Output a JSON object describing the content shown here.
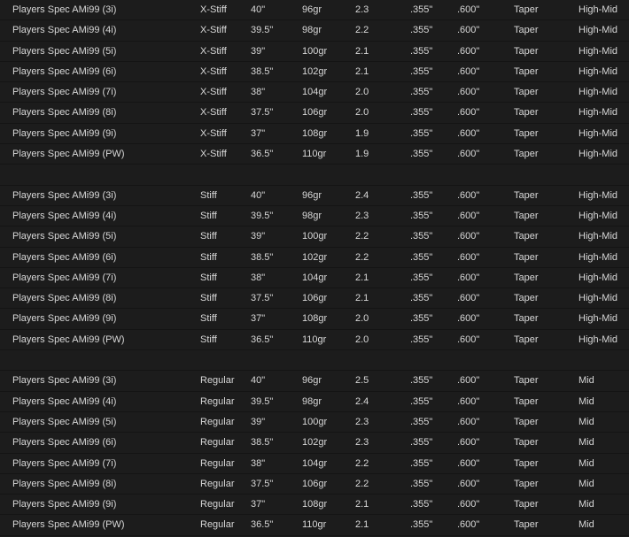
{
  "groups": [
    {
      "rows": [
        [
          "Players Spec AMi99 (3i)",
          "X-Stiff",
          "40\"",
          "96gr",
          "2.3",
          ".355\"",
          ".600\"",
          "Taper",
          "High-Mid"
        ],
        [
          "Players Spec AMi99 (4i)",
          "X-Stiff",
          "39.5\"",
          "98gr",
          "2.2",
          ".355\"",
          ".600\"",
          "Taper",
          "High-Mid"
        ],
        [
          "Players Spec AMi99 (5i)",
          "X-Stiff",
          "39\"",
          "100gr",
          "2.1",
          ".355\"",
          ".600\"",
          "Taper",
          "High-Mid"
        ],
        [
          "Players Spec AMi99 (6i)",
          "X-Stiff",
          "38.5\"",
          "102gr",
          "2.1",
          ".355\"",
          ".600\"",
          "Taper",
          "High-Mid"
        ],
        [
          "Players Spec AMi99 (7i)",
          "X-Stiff",
          "38\"",
          "104gr",
          "2.0",
          ".355\"",
          ".600\"",
          "Taper",
          "High-Mid"
        ],
        [
          "Players Spec AMi99 (8i)",
          "X-Stiff",
          "37.5\"",
          "106gr",
          "2.0",
          ".355\"",
          ".600\"",
          "Taper",
          "High-Mid"
        ],
        [
          "Players Spec AMi99 (9i)",
          "X-Stiff",
          "37\"",
          "108gr",
          "1.9",
          ".355\"",
          ".600\"",
          "Taper",
          "High-Mid"
        ],
        [
          "Players Spec AMi99 (PW)",
          "X-Stiff",
          "36.5\"",
          "110gr",
          "1.9",
          ".355\"",
          ".600\"",
          "Taper",
          "High-Mid"
        ]
      ]
    },
    {
      "rows": [
        [
          "Players Spec AMi99 (3i)",
          "Stiff",
          "40\"",
          "96gr",
          "2.4",
          ".355\"",
          ".600\"",
          "Taper",
          "High-Mid"
        ],
        [
          "Players Spec AMi99 (4i)",
          "Stiff",
          "39.5\"",
          "98gr",
          "2.3",
          ".355\"",
          ".600\"",
          "Taper",
          "High-Mid"
        ],
        [
          "Players Spec AMi99 (5i)",
          "Stiff",
          "39\"",
          "100gr",
          "2.2",
          ".355\"",
          ".600\"",
          "Taper",
          "High-Mid"
        ],
        [
          "Players Spec AMi99 (6i)",
          "Stiff",
          "38.5\"",
          "102gr",
          "2.2",
          ".355\"",
          ".600\"",
          "Taper",
          "High-Mid"
        ],
        [
          "Players Spec AMi99 (7i)",
          "Stiff",
          "38\"",
          "104gr",
          "2.1",
          ".355\"",
          ".600\"",
          "Taper",
          "High-Mid"
        ],
        [
          "Players Spec AMi99 (8i)",
          "Stiff",
          "37.5\"",
          "106gr",
          "2.1",
          ".355\"",
          ".600\"",
          "Taper",
          "High-Mid"
        ],
        [
          "Players Spec AMi99 (9i)",
          "Stiff",
          "37\"",
          "108gr",
          "2.0",
          ".355\"",
          ".600\"",
          "Taper",
          "High-Mid"
        ],
        [
          "Players Spec AMi99 (PW)",
          "Stiff",
          "36.5\"",
          "110gr",
          "2.0",
          ".355\"",
          ".600\"",
          "Taper",
          "High-Mid"
        ]
      ]
    },
    {
      "rows": [
        [
          "Players Spec AMi99 (3i)",
          "Regular",
          "40\"",
          "96gr",
          "2.5",
          ".355\"",
          ".600\"",
          "Taper",
          "Mid"
        ],
        [
          "Players Spec AMi99 (4i)",
          "Regular",
          "39.5\"",
          "98gr",
          "2.4",
          ".355\"",
          ".600\"",
          "Taper",
          "Mid"
        ],
        [
          "Players Spec AMi99 (5i)",
          "Regular",
          "39\"",
          "100gr",
          "2.3",
          ".355\"",
          ".600\"",
          "Taper",
          "Mid"
        ],
        [
          "Players Spec AMi99 (6i)",
          "Regular",
          "38.5\"",
          "102gr",
          "2.3",
          ".355\"",
          ".600\"",
          "Taper",
          "Mid"
        ],
        [
          "Players Spec AMi99 (7i)",
          "Regular",
          "38\"",
          "104gr",
          "2.2",
          ".355\"",
          ".600\"",
          "Taper",
          "Mid"
        ],
        [
          "Players Spec AMi99 (8i)",
          "Regular",
          "37.5\"",
          "106gr",
          "2.2",
          ".355\"",
          ".600\"",
          "Taper",
          "Mid"
        ],
        [
          "Players Spec AMi99 (9i)",
          "Regular",
          "37\"",
          "108gr",
          "2.1",
          ".355\"",
          ".600\"",
          "Taper",
          "Mid"
        ],
        [
          "Players Spec AMi99 (PW)",
          "Regular",
          "36.5\"",
          "110gr",
          "2.1",
          ".355\"",
          ".600\"",
          "Taper",
          "Mid"
        ]
      ]
    }
  ]
}
